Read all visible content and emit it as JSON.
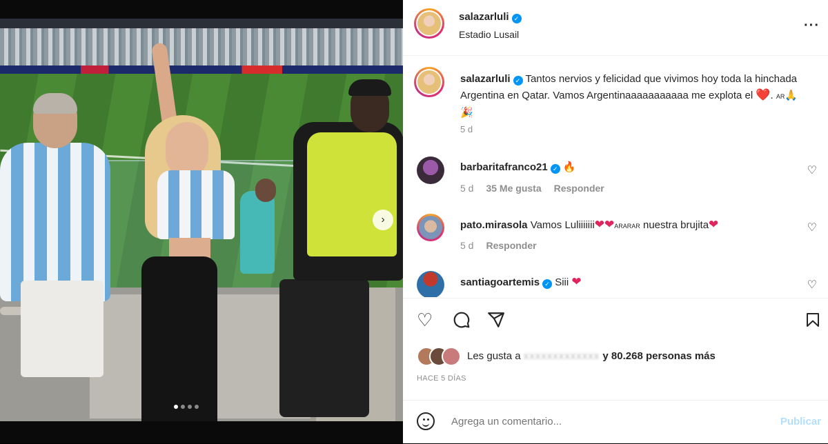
{
  "post": {
    "author": "salazarluli",
    "location": "Estadio Lusail",
    "more_icon": "more-horizontal-icon",
    "caption_text": "Tantos nervios y felicidad que vivimos hoy toda la hinchada Argentina en Qatar. Vamos Argentinaaaaaaaaaaa me explota el",
    "caption_tail": ". ",
    "caption_emoji_flag": "AR",
    "caption_time": "5 d",
    "media_dots": 4,
    "active_dot": 0
  },
  "comments": [
    {
      "user": "barbaritafranco21",
      "verified": true,
      "text": "🔥",
      "time": "5 d",
      "likes": "35 Me gusta",
      "reply": "Responder"
    },
    {
      "user": "pato.mirasola",
      "verified": false,
      "text_a": "Vamos Luliiiiiii",
      "text_b": "ARARAR",
      "text_c": "nuestra brujita",
      "time": "5 d",
      "reply": "Responder"
    },
    {
      "user": "santiagoartemis",
      "verified": true,
      "text": "Siii"
    }
  ],
  "footer": {
    "likes_prefix": "Les gusta a",
    "likes_blurred": "xxxxxxxxxxxxx",
    "likes_suffix": "y 80.268 personas más",
    "posted_ago": "HACE 5 DÍAS",
    "comment_placeholder": "Agrega un comentario...",
    "publish_label": "Publicar"
  },
  "colors": {
    "link_blue": "#0095f6",
    "publish_disabled": "#b2dffc",
    "heart_red": "#e0245e",
    "secondary_text": "#8e8e8e"
  }
}
